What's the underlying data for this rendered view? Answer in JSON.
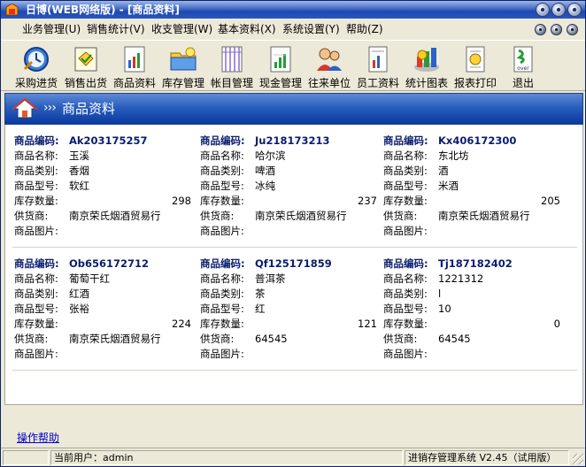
{
  "window": {
    "title": "日博(WEB网络版) - [商品资料]"
  },
  "menu": [
    {
      "label": "业务管理(U)"
    },
    {
      "label": "销售统计(V)"
    },
    {
      "label": "收支管理(W)"
    },
    {
      "label": "基本资料(X)"
    },
    {
      "label": "系统设置(Y)"
    },
    {
      "label": "帮助(Z)"
    }
  ],
  "toolbar": [
    {
      "label": "采购进货",
      "icon": "clock-purchase-icon"
    },
    {
      "label": "销售出货",
      "icon": "sales-certificate-icon"
    },
    {
      "label": "商品资料",
      "icon": "goods-document-icon"
    },
    {
      "label": "库存管理",
      "icon": "inventory-folder-icon"
    },
    {
      "label": "帐目管理",
      "icon": "ledger-grid-icon"
    },
    {
      "label": "现金管理",
      "icon": "cash-chart-icon"
    },
    {
      "label": "往来单位",
      "icon": "contacts-people-icon"
    },
    {
      "label": "员工资料",
      "icon": "staff-document-icon"
    },
    {
      "label": "统计图表",
      "icon": "statistics-chart-icon"
    },
    {
      "label": "报表打印",
      "icon": "report-print-icon"
    },
    {
      "label": "退出",
      "icon": "exit-over-icon"
    }
  ],
  "banner": {
    "arrows": "›››",
    "title": "商品资料"
  },
  "labels": {
    "code": "商品编码:",
    "name": "商品名称:",
    "category": "商品类别:",
    "model": "商品型号:",
    "stock": "库存数量:",
    "supplier": "供货商:",
    "image": "商品图片:"
  },
  "products": [
    {
      "code": "Ak203175257",
      "name": "玉溪",
      "category": "香烟",
      "model": "软红",
      "stock": "298",
      "supplier": "南京荣氏烟酒贸易行"
    },
    {
      "code": "Ju218173213",
      "name": "哈尔滨",
      "category": "啤酒",
      "model": "冰纯",
      "stock": "237",
      "supplier": "南京荣氏烟酒贸易行"
    },
    {
      "code": "Kx406172300",
      "name": "东北坊",
      "category": "酒",
      "model": "米酒",
      "stock": "205",
      "supplier": "南京荣氏烟酒贸易行"
    },
    {
      "code": "Ob656172712",
      "name": "葡萄干红",
      "category": "红酒",
      "model": "张裕",
      "stock": "224",
      "supplier": "南京荣氏烟酒贸易行"
    },
    {
      "code": "Qf125171859",
      "name": "普洱茶",
      "category": "茶",
      "model": "红",
      "stock": "121",
      "supplier": "64545"
    },
    {
      "code": "Tj187182402",
      "name": "1221312",
      "category": "l",
      "model": "10",
      "stock": "0",
      "supplier": "64545"
    }
  ],
  "help": {
    "link": "操作帮助"
  },
  "status": {
    "user": "当前用户：admin",
    "system": "进销存管理系统 V2.45（试用版）"
  },
  "colors": {
    "title_bar": "#1e47b0",
    "banner": "#2a5ebd",
    "code_text": "#0a1d6e",
    "help_link": "#0000cc"
  }
}
